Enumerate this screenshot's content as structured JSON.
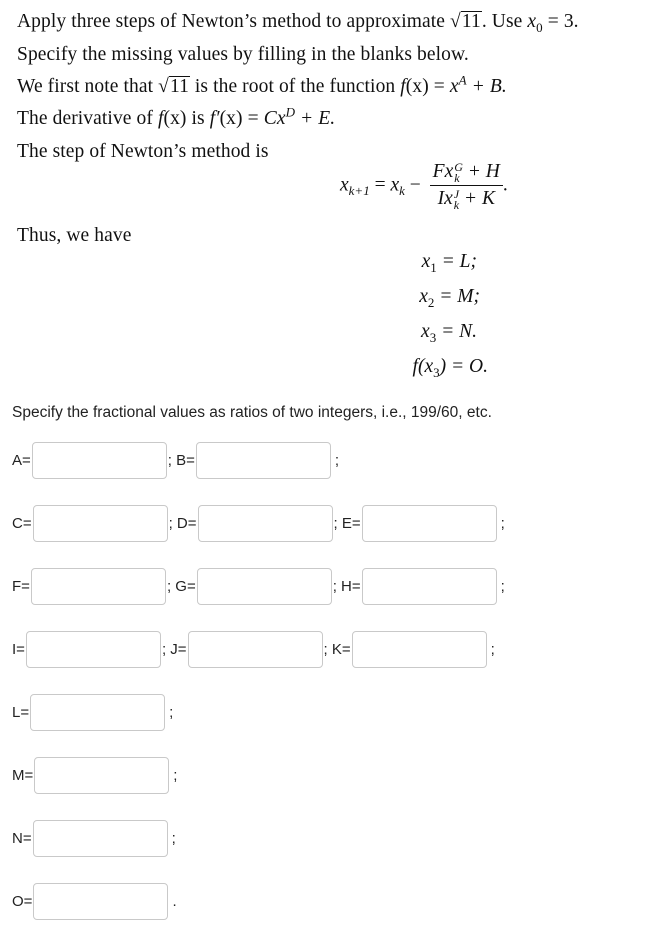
{
  "problem": {
    "line1": {
      "prefix": "Apply three steps of Newton’s method to approximate ",
      "radicand": "11",
      "mid": ". Use ",
      "x0_var": "x",
      "x0_sub": "0",
      "x0_eq": " = 3."
    },
    "line2": "Specify the missing values by filling in the blanks below.",
    "line3": {
      "prefix": "We first note that ",
      "radicand": "11",
      "mid": " is the root of the function ",
      "f": "f",
      "arg": "(x)",
      "eq": " = ",
      "x": "x",
      "exp": "A",
      "tail": " + B."
    },
    "line4": {
      "prefix": "The derivative of ",
      "f": "f",
      "arg": "(x)",
      "is": " is ",
      "fprime": "f′",
      "eq": " = ",
      "C": "C",
      "x": "x",
      "exp": "D",
      "tail": " + E."
    },
    "line5": "The step of Newton’s method is",
    "newton_formula": {
      "lhs": "x",
      "lhs_sub": "k+1",
      "eq": " = ",
      "xk": "x",
      "xk_sub": "k",
      "minus": " − ",
      "num_coef": "F",
      "num_x": "x",
      "num_sup": "G",
      "num_sub": "k",
      "num_tail": " + H",
      "den_coef": "I",
      "den_x": "x",
      "den_sup": "J",
      "den_sub": "k",
      "den_tail": " + K",
      "end": "."
    },
    "thus": "Thus, we have",
    "results": [
      {
        "lhs": "x",
        "sub": "1",
        "rhs": " = L;"
      },
      {
        "lhs": "x",
        "sub": "2",
        "rhs": " = M;"
      },
      {
        "lhs": "x",
        "sub": "3",
        "rhs": " = N."
      },
      {
        "lhs": "f(x",
        "sub": "3",
        "rhs": ") = O."
      }
    ]
  },
  "instruction": "Specify the fractional values as ratios of two integers, i.e., 199/60, etc.",
  "answer_rows": [
    {
      "fields": [
        {
          "label": "A=",
          "value": "",
          "placeholder": ""
        },
        {
          "label": "; B=",
          "value": "",
          "placeholder": ""
        }
      ],
      "terminator": ";"
    },
    {
      "fields": [
        {
          "label": "C=",
          "value": "",
          "placeholder": ""
        },
        {
          "label": "; D=",
          "value": "",
          "placeholder": ""
        },
        {
          "label": "; E=",
          "value": "",
          "placeholder": ""
        }
      ],
      "terminator": ";"
    },
    {
      "fields": [
        {
          "label": "F=",
          "value": "",
          "placeholder": ""
        },
        {
          "label": "; G=",
          "value": "",
          "placeholder": ""
        },
        {
          "label": "; H=",
          "value": "",
          "placeholder": ""
        }
      ],
      "terminator": ";"
    },
    {
      "fields": [
        {
          "label": "I=",
          "value": "",
          "placeholder": ""
        },
        {
          "label": "; J=",
          "value": "",
          "placeholder": ""
        },
        {
          "label": "; K=",
          "value": "",
          "placeholder": ""
        }
      ],
      "terminator": ";"
    },
    {
      "fields": [
        {
          "label": "L=",
          "value": "",
          "placeholder": ""
        }
      ],
      "terminator": ";"
    },
    {
      "fields": [
        {
          "label": "M=",
          "value": "",
          "placeholder": ""
        }
      ],
      "terminator": ";"
    },
    {
      "fields": [
        {
          "label": "N=",
          "value": "",
          "placeholder": ""
        }
      ],
      "terminator": ";"
    },
    {
      "fields": [
        {
          "label": "O=",
          "value": "",
          "placeholder": ""
        }
      ],
      "terminator": "."
    }
  ]
}
